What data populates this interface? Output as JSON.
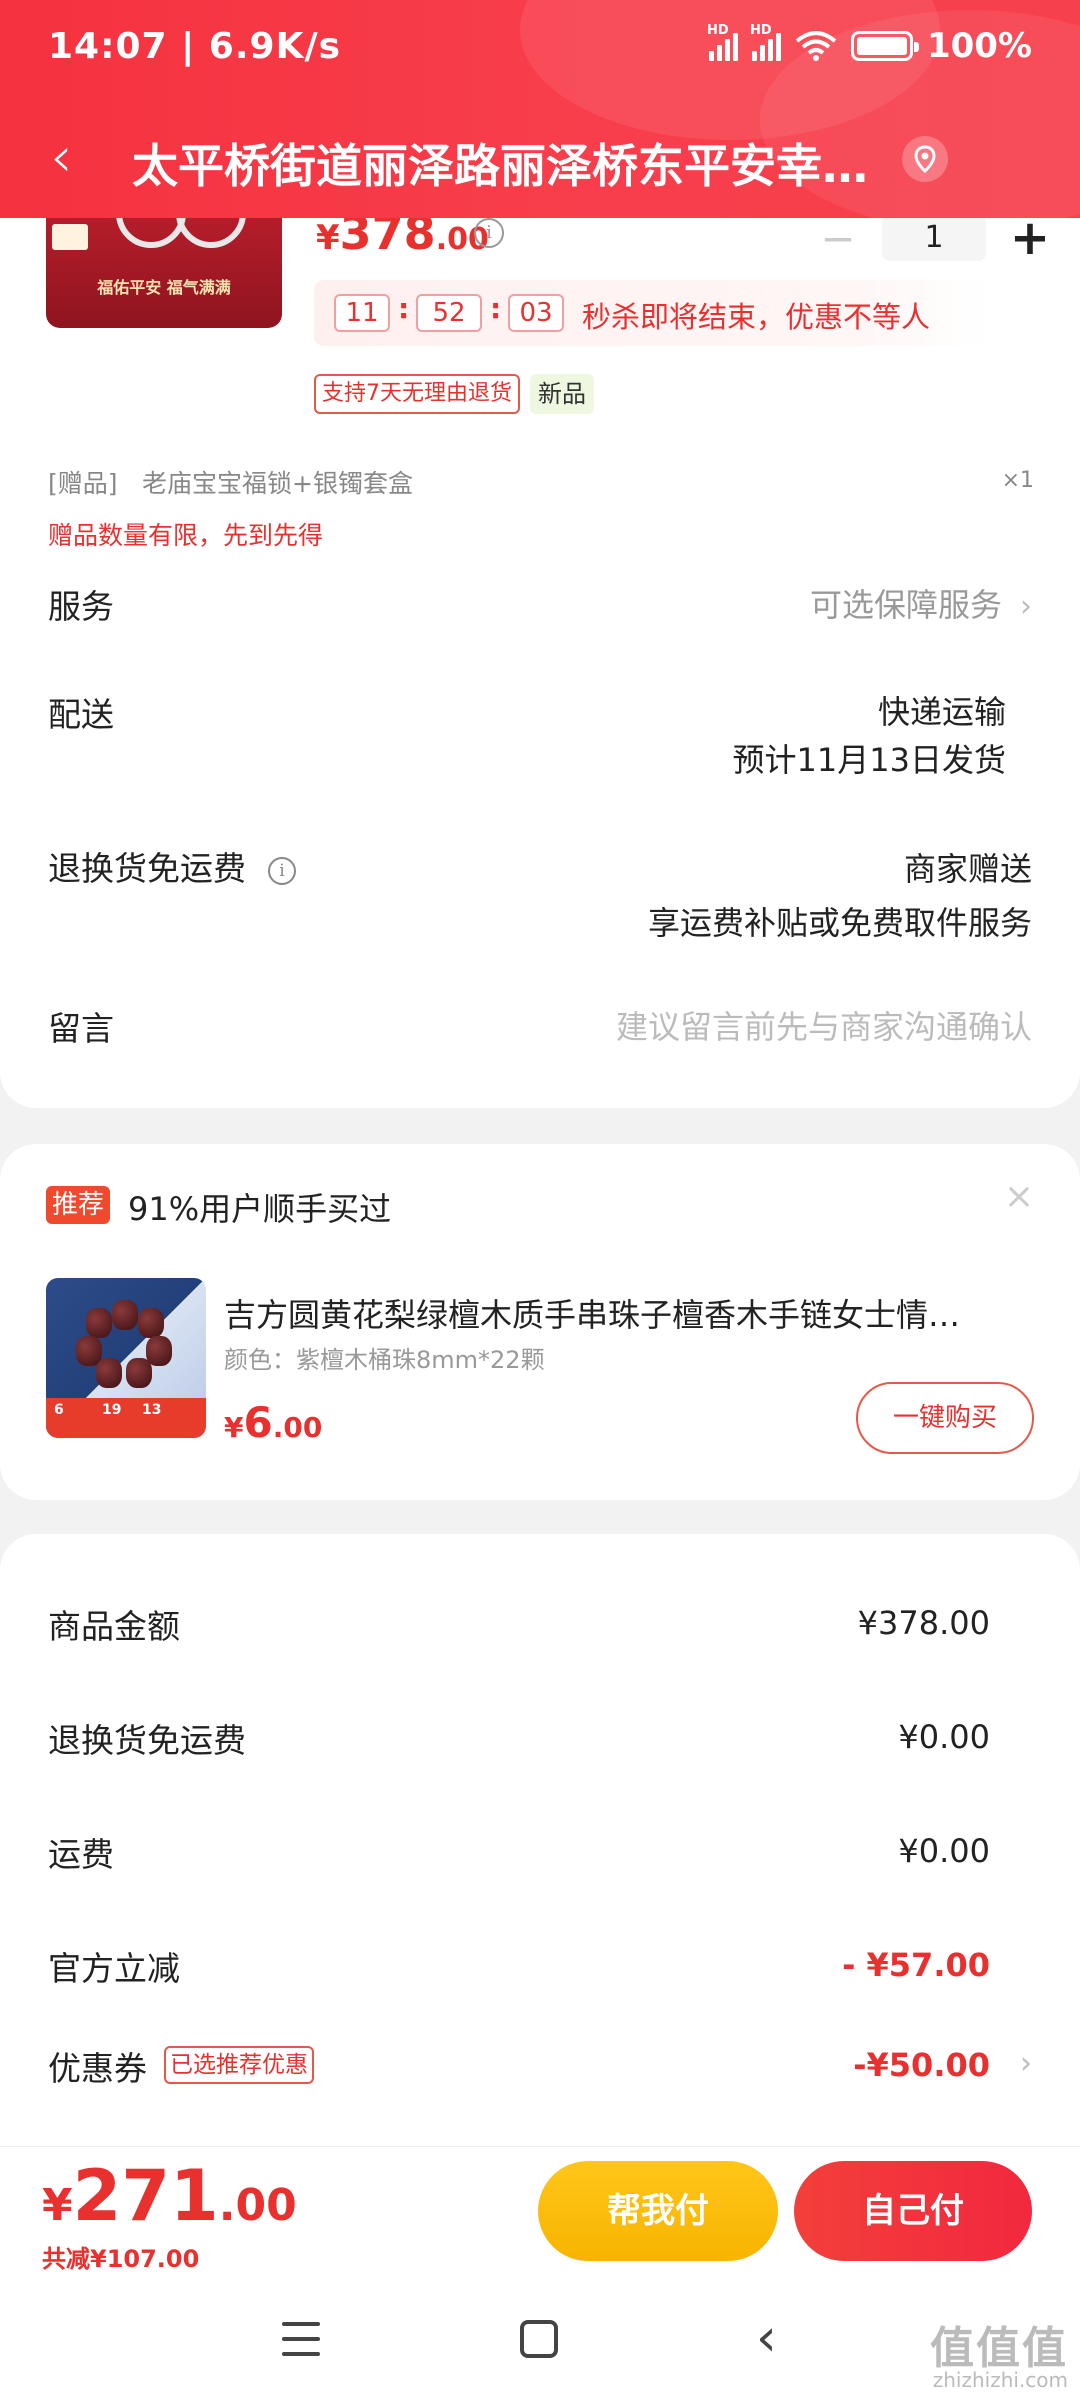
{
  "status_bar": {
    "time": "14:07 | 6.9K/s",
    "hd1": "HD",
    "hd2": "HD",
    "battery": "100%"
  },
  "nav": {
    "address": "太平桥街道丽泽路丽泽桥东平安幸…"
  },
  "product": {
    "image_title": "福佑平安 福气满满",
    "price_symbol": "¥",
    "price_int": "378",
    "price_dec": ".00",
    "quantity": "1",
    "countdown": [
      "11",
      "52",
      "03"
    ],
    "flash_message": "秒杀即将结束，优惠不等人",
    "tag_return": "支持7天无理由退货",
    "tag_new": "新品"
  },
  "gift": {
    "label": "[赠品]",
    "name": "老庙宝宝福锁+银镯套盒",
    "qty": "×1",
    "note": "赠品数量有限，先到先得"
  },
  "service": {
    "label": "服务",
    "value": "可选保障服务"
  },
  "delivery": {
    "label": "配送",
    "method": "快递运输",
    "eta": "预计11月13日发货"
  },
  "return_shipping": {
    "label": "退换货免运费",
    "value1": "商家赠送",
    "value2": "享运费补贴或免费取件服务"
  },
  "message": {
    "label": "留言",
    "placeholder": "建议留言前先与商家沟通确认"
  },
  "recommend": {
    "badge": "推荐",
    "title": "91%用户顺手买过",
    "name": "吉方圆黄花梨绿檀木质手串珠子檀香木手链女士情…",
    "spec": "颜色：紫檀木桶珠8mm*22颗",
    "price_symbol": "¥",
    "price_int": "6",
    "price_dec": ".00",
    "buy_label": "一键购买"
  },
  "summary": [
    {
      "label": "商品金额",
      "value": "¥378.00"
    },
    {
      "label": "退换货免运费",
      "value": "¥0.00"
    },
    {
      "label": "运费",
      "value": "¥0.00"
    },
    {
      "label": "官方立减",
      "value": "- ¥57.00"
    },
    {
      "label": "优惠券",
      "tag": "已选推荐优惠",
      "value": "-¥50.00"
    }
  ],
  "paybar": {
    "total_symbol": "¥",
    "total_int": "271",
    "total_dec": ".00",
    "saved": "共减¥107.00",
    "help_pay": "帮我付",
    "self_pay": "自己付"
  },
  "watermark": {
    "text": "值值值",
    "domain": "zhizhizhi.com"
  },
  "colors": {
    "accent": "#f5323f",
    "price_red": "#e8312f",
    "help_yellow": "#ffc61a"
  }
}
